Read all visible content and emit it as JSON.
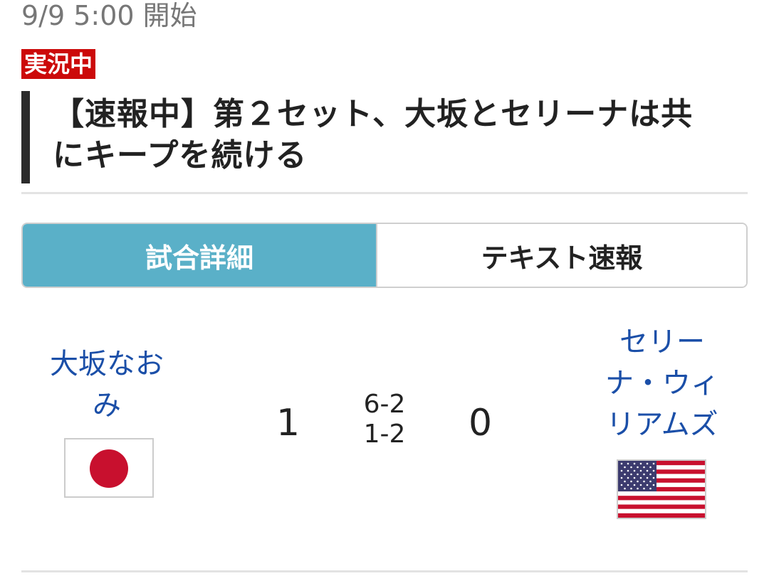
{
  "header": {
    "datetime": "9/9 5:00 開始",
    "live_badge": "実況中",
    "headline": "【速報中】第２セット、大坂とセリーナは共にキープを続ける"
  },
  "tabs": [
    {
      "label": "試合詳細",
      "active": true
    },
    {
      "label": "テキスト速報",
      "active": false
    }
  ],
  "match": {
    "player1": {
      "name": "大坂なおみ",
      "sets_won": "1",
      "flag": "japan-flag-icon"
    },
    "player2": {
      "name": "セリーナ・ウィリアムズ",
      "sets_won": "0",
      "flag": "usa-flag-icon"
    },
    "set_scores": [
      "6-2",
      "1-2"
    ]
  },
  "colors": {
    "badge": "#cc0a0a",
    "tab_active": "#5ab0c8",
    "player_link": "#1b4fa8"
  }
}
